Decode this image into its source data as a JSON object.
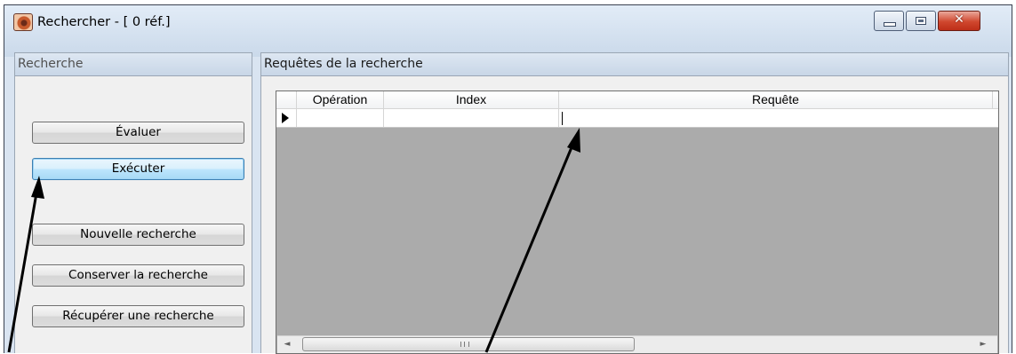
{
  "window": {
    "title": "Rechercher - [ 0 réf.]",
    "icon": "eye-app-icon",
    "controls": {
      "minimize": "minimize-icon",
      "maximize": "maximize-icon",
      "close_glyph": "✕"
    }
  },
  "left_pane": {
    "header": "Recherche",
    "buttons": {
      "evaluate": "Évaluer",
      "execute": "Exécuter",
      "new_search": "Nouvelle recherche",
      "keep_search": "Conserver la recherche",
      "retrieve_search": "Récupérer une recherche"
    }
  },
  "right_pane": {
    "header": "Requêtes de la recherche",
    "grid": {
      "columns": [
        "Opération",
        "Index",
        "Requête"
      ],
      "rows": [
        {
          "indicator": "current-row",
          "operation": "",
          "index": "",
          "requete": ""
        }
      ]
    },
    "scrollbar": {
      "left_arrow": "◄",
      "right_arrow": "►",
      "grip": "grip-icon"
    }
  },
  "colors": {
    "title_bar": "#d3e0ee",
    "grid_background": "#ababab",
    "close_button": "#c8452c",
    "focused_button": "#bee6fd"
  }
}
